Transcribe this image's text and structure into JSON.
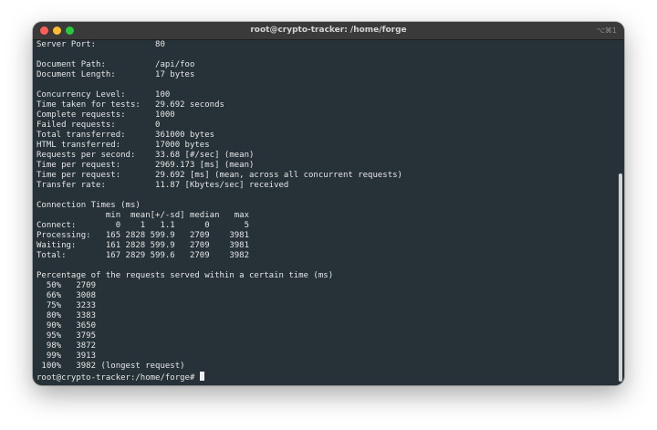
{
  "window": {
    "title": "root@crypto-tracker: /home/forge",
    "shortcut": "⌥⌘1"
  },
  "terminal": {
    "lines": [
      "Server Port:            80",
      "",
      "Document Path:          /api/foo",
      "Document Length:        17 bytes",
      "",
      "Concurrency Level:      100",
      "Time taken for tests:   29.692 seconds",
      "Complete requests:      1000",
      "Failed requests:        0",
      "Total transferred:      361000 bytes",
      "HTML transferred:       17000 bytes",
      "Requests per second:    33.68 [#/sec] (mean)",
      "Time per request:       2969.173 [ms] (mean)",
      "Time per request:       29.692 [ms] (mean, across all concurrent requests)",
      "Transfer rate:          11.87 [Kbytes/sec] received",
      "",
      "Connection Times (ms)",
      "              min  mean[+/-sd] median   max",
      "Connect:        0    1   1.1      0       5",
      "Processing:   165 2828 599.9   2709    3981",
      "Waiting:      161 2828 599.9   2709    3981",
      "Total:        167 2829 599.6   2709    3982",
      "",
      "Percentage of the requests served within a certain time (ms)",
      "  50%   2709",
      "  66%   3008",
      "  75%   3233",
      "  80%   3383",
      "  90%   3650",
      "  95%   3795",
      "  98%   3872",
      "  99%   3913",
      " 100%   3982 (longest request)"
    ],
    "prompt": "root@crypto-tracker:/home/forge# "
  },
  "colors": {
    "background": "#263238",
    "text": "#e6e6e6",
    "titlebar": "#3a3a3a"
  }
}
